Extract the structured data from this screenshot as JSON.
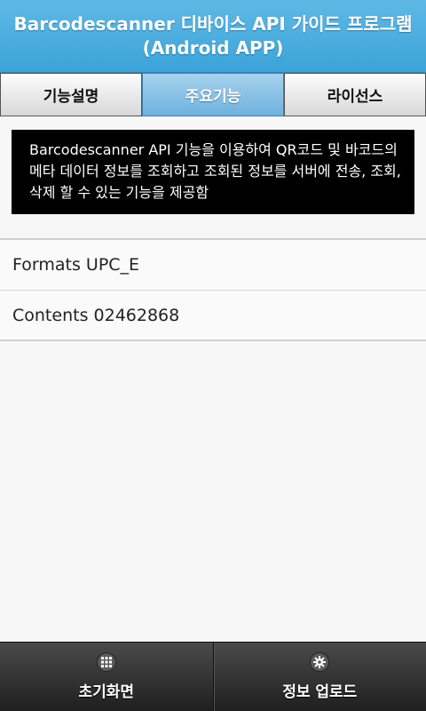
{
  "header": {
    "title_line1": "Barcodescanner 디바이스 API 가이드 프로그램",
    "title_line2": "(Android APP)"
  },
  "tabs": [
    {
      "label": "기능설명",
      "active": false
    },
    {
      "label": "주요기능",
      "active": true
    },
    {
      "label": "라이선스",
      "active": false
    }
  ],
  "description": "Barcodescanner API 기능을 이용하여 QR코드 및 바코드의 메타 데이터 정보를 조회하고 조회된 정보를 서버에 전송, 조회, 삭제 할 수 있는 기능을 제공함",
  "results": [
    {
      "label": "Formats",
      "value": "UPC_E"
    },
    {
      "label": "Contents",
      "value": "02462868"
    }
  ],
  "footer": {
    "home": {
      "label": "초기화면",
      "icon": "grid-icon"
    },
    "upload": {
      "label": "정보 업로드",
      "icon": "gear-icon"
    }
  },
  "colors": {
    "header": "#3ba3d8",
    "active_tab": "#6fb2de",
    "description_bg": "#000000"
  }
}
